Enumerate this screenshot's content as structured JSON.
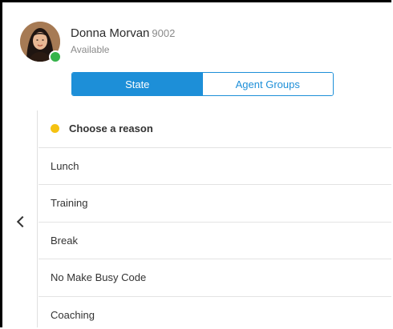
{
  "agent": {
    "name": "Donna Morvan",
    "extension": "9002",
    "status": "Available",
    "status_color": "#36b34a"
  },
  "tabs": {
    "state_label": "State",
    "agent_groups_label": "Agent Groups",
    "active": "State",
    "accent_color": "#1d8fd8"
  },
  "reasons": {
    "header": "Choose a reason",
    "header_dot_color": "#f5c211",
    "items": [
      "Lunch",
      "Training",
      "Break",
      "No Make Busy Code",
      "Coaching"
    ]
  },
  "icons": {
    "back": "chevron-left-icon",
    "status": "status-dot-icon"
  }
}
